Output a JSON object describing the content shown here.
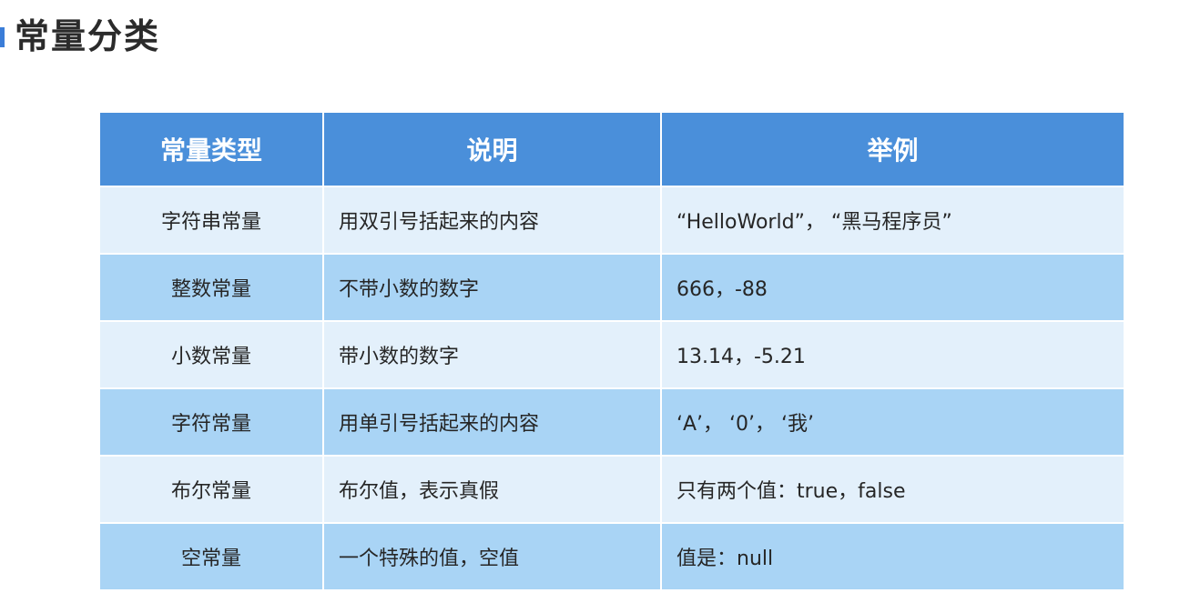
{
  "title": "常量分类",
  "table": {
    "headers": [
      "常量类型",
      "说明",
      "举例"
    ],
    "rows": [
      {
        "type": "字符串常量",
        "desc": "用双引号括起来的内容",
        "example": " “HelloWorld”， “黑马程序员”"
      },
      {
        "type": "整数常量",
        "desc": "不带小数的数字",
        "example": "666，-88"
      },
      {
        "type": "小数常量",
        "desc": "带小数的数字",
        "example": "13.14，-5.21"
      },
      {
        "type": "字符常量",
        "desc": "用单引号括起来的内容",
        "example": " ‘A’， ‘0’，  ‘我’"
      },
      {
        "type": "布尔常量",
        "desc": "布尔值，表示真假",
        "example": "只有两个值：true，false"
      },
      {
        "type": "空常量",
        "desc": "一个特殊的值，空值",
        "example": "值是：null"
      }
    ]
  },
  "colors": {
    "header_bg": "#4a8fda",
    "row_light": "#e3f0fb",
    "row_dark": "#a9d4f5"
  }
}
